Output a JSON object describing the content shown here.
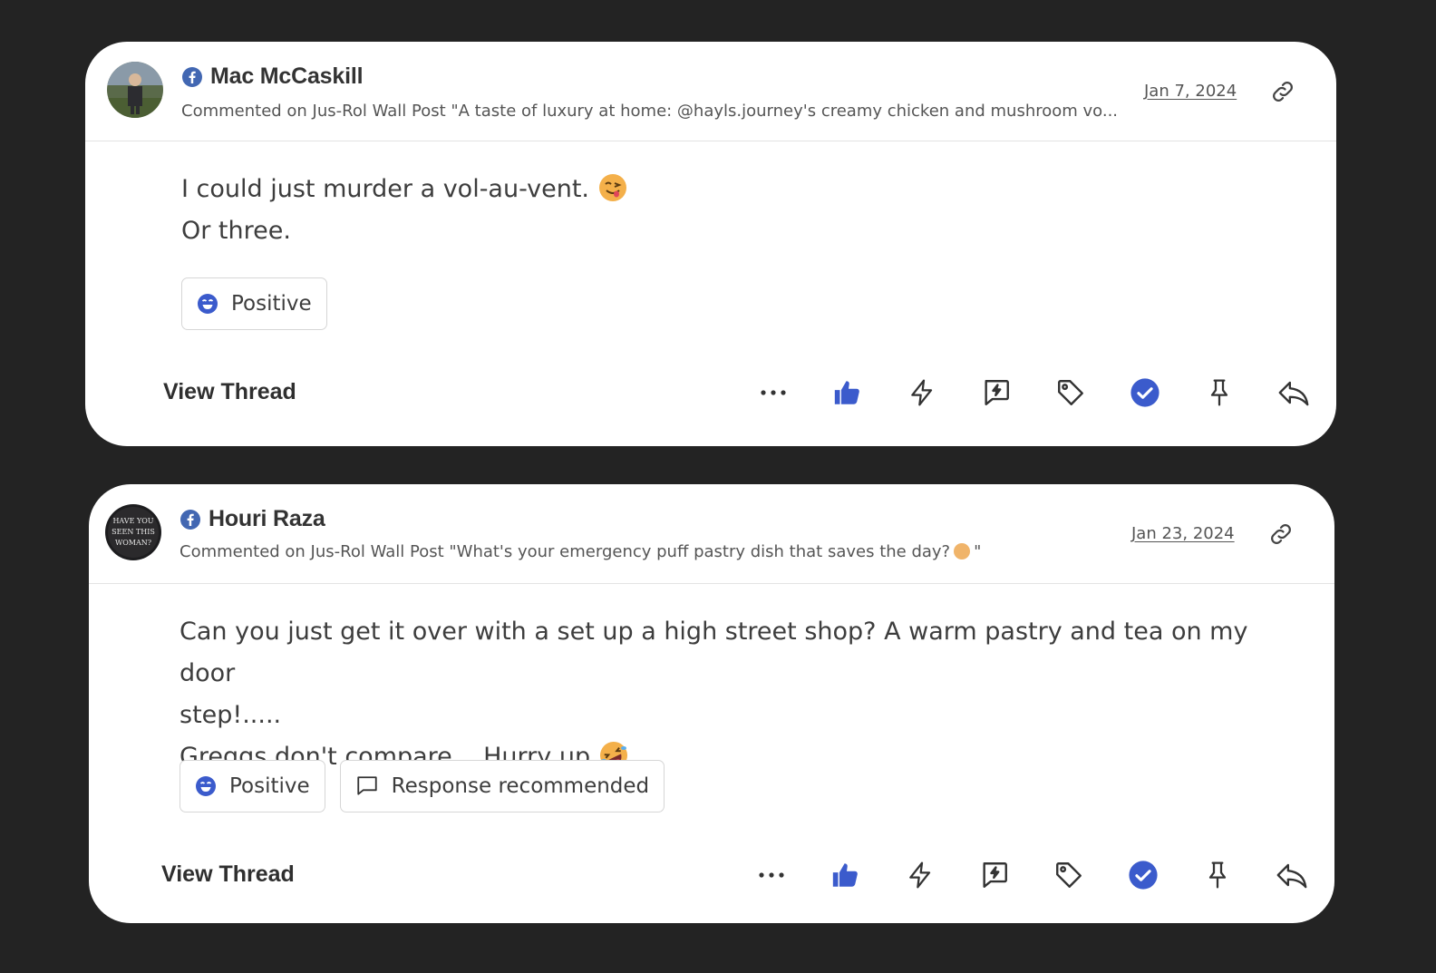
{
  "colors": {
    "background": "#232323",
    "card": "#ffffff",
    "accent_blue": "#3b5bcc",
    "facebook_blue": "#4267b2"
  },
  "posts": [
    {
      "author": "Mac McCaskill",
      "platform_icon": "facebook-icon",
      "subtitle": "Commented on Jus-Rol Wall Post \"A taste of luxury at home: @hayls.journey's creamy chicken and mushroom vo...",
      "date": "Jan 7, 2024",
      "message_lines": [
        "I could just murder a vol-au-vent.",
        "Or three."
      ],
      "message_emoji": "face-savoring-food-emoji",
      "tags": [
        {
          "label": "Positive",
          "icon": "positive-sentiment-icon"
        }
      ],
      "view_thread_label": "View Thread",
      "actions": [
        "more-icon",
        "thumbs-up-icon",
        "lightning-icon",
        "quick-reply-icon",
        "tag-icon",
        "check-circle-icon",
        "pin-icon",
        "reply-icon"
      ]
    },
    {
      "author": "Houri Raza",
      "platform_icon": "facebook-icon",
      "subtitle": "Commented on Jus-Rol Wall Post \"What's your emergency puff pastry dish that saves the day?",
      "subtitle_end": "\"",
      "date": "Jan 23, 2024",
      "message_lines": [
        "Can you just get it over with a set up a high street shop? A warm pastry and tea on my door",
        "step!.....",
        "Greggs don't compare... Hurry up"
      ],
      "message_emoji": "rolling-on-floor-laughing-emoji",
      "tags": [
        {
          "label": "Positive",
          "icon": "positive-sentiment-icon"
        },
        {
          "label": "Response recommended",
          "icon": "comment-icon"
        }
      ],
      "view_thread_label": "View Thread",
      "actions": [
        "more-icon",
        "thumbs-up-icon",
        "lightning-icon",
        "quick-reply-icon",
        "tag-icon",
        "check-circle-icon",
        "pin-icon",
        "reply-icon"
      ]
    }
  ]
}
